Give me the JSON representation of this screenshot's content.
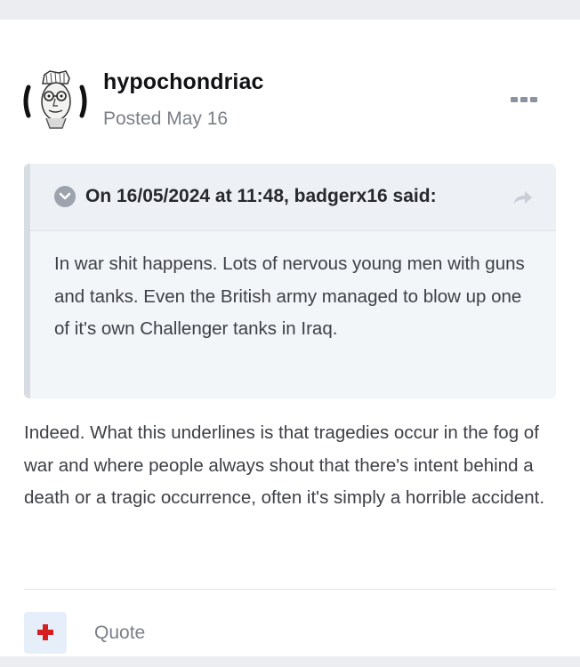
{
  "post": {
    "author": "hypochondriac",
    "date": "Posted May 16",
    "quote": {
      "attribution": "On 16/05/2024 at 11:48, badgerx16 said:",
      "text": "In war shit happens. Lots of nervous young men with guns and tanks. Even the British army managed to blow up one of it's own Challenger tanks in Iraq."
    },
    "body": "Indeed. What this underlines is that tragedies occur in the fog of war and where people always shout that there's intent behind a death or a tragic occurrence, often it's simply a horrible accident.",
    "actions": {
      "quote_label": "Quote"
    }
  },
  "icons": {
    "menu": "ellipsis-icon",
    "collapse": "chevron-down-icon",
    "share": "share-arrow-icon",
    "react": "plus-icon"
  },
  "colors": {
    "react_plus": "#d51f20",
    "react_bg": "#e6eff9",
    "quote_bg": "#f3f6f9"
  }
}
